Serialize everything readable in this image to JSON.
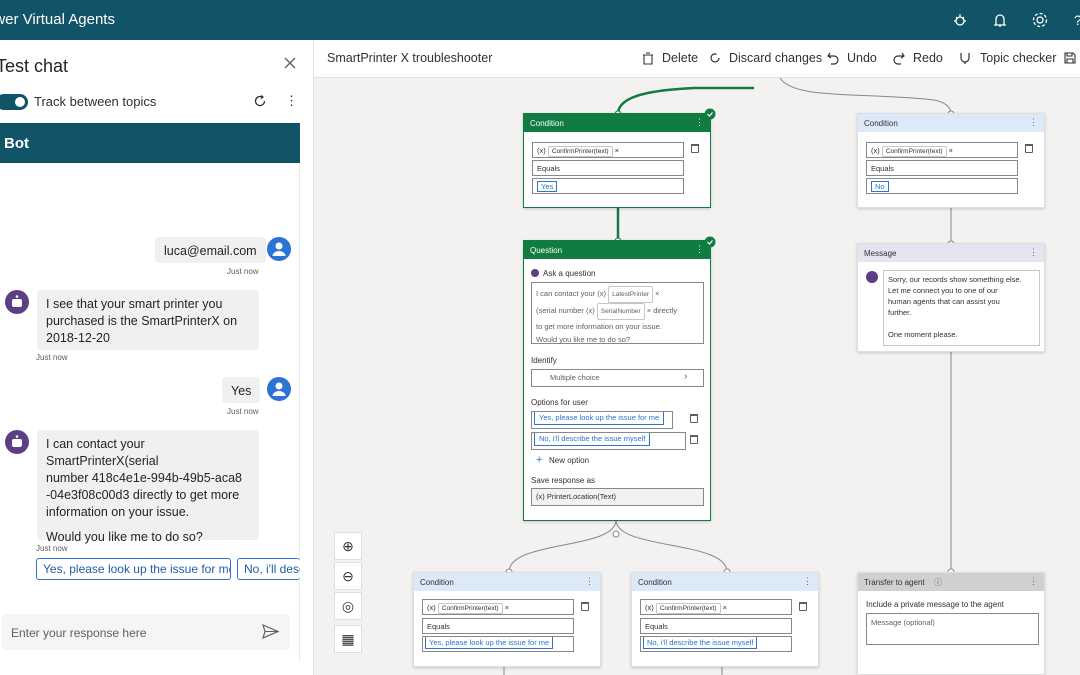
{
  "app": {
    "title": "ower Virtual Agents",
    "colors": {
      "brand": "#115468",
      "accent": "#2b73d4",
      "bot_avatar": "#5c3f84",
      "condition_ok": "#107c41"
    }
  },
  "topbar_icons": [
    "bug-icon",
    "bell-icon",
    "gear-icon",
    "help-icon"
  ],
  "chat": {
    "title": "Test chat",
    "track_label": "Track between topics",
    "track_on": true,
    "bot_header": "Bot",
    "messages": [
      {
        "from": "user",
        "text": "luca@email.com",
        "time": "Just now"
      },
      {
        "from": "bot",
        "lines": [
          "I see that your smart printer you",
          "purchased is the SmartPrinterX on",
          "2018-12-20"
        ],
        "time": "Just now"
      },
      {
        "from": "user",
        "text": "Yes",
        "time": "Just now"
      },
      {
        "from": "bot",
        "lines": [
          "I can contact your SmartPrinterX(serial",
          "number 418c4e1e-994b-49b5-aca8",
          "-04e3f08c00d3 directly to get more",
          "information on your issue.",
          "",
          "Would you like me to do so?"
        ],
        "time": "Just now"
      }
    ],
    "suggestions": [
      "Yes, please look up the issue for me",
      "No, i'll desc"
    ],
    "input_placeholder": "Enter your response here"
  },
  "canvas": {
    "topic_name": "SmartPrinter X troubleshooter",
    "toolbar": {
      "delete": "Delete",
      "discard": "Discard changes",
      "undo": "Undo",
      "redo": "Redo",
      "checker": "Topic checker"
    },
    "cond_top_left": {
      "header": "Condition",
      "var": "ConfirmPrinter(text)",
      "op": "Equals",
      "value": "Yes"
    },
    "cond_top_right": {
      "header": "Condition",
      "var": "ConfirmPrinter(text)",
      "op": "Equals",
      "value": "No"
    },
    "question": {
      "header": "Question",
      "ask_label": "Ask a question",
      "text_a": "I can contact your",
      "chip_a": "LatestPrinter",
      "text_b": "(serial number",
      "chip_b": "SerialNumber",
      "text_c": "directly",
      "text_d": "to get more information on your issue.",
      "text_e": "Would you like me to do so?",
      "identify_label": "Identify",
      "identify_value": "Multiple choice",
      "options_label": "Options for user",
      "options": [
        "Yes, please look up the issue for me",
        "No, i'll describe the issue myself"
      ],
      "new_option": "New option",
      "save_label": "Save response as",
      "save_value": "PrinterLocation(Text)"
    },
    "message": {
      "header": "Message",
      "lines": [
        "Sorry, our records show something else.",
        "Let me connect you to one of our",
        "human agents that can assist you",
        "further.",
        "",
        "One moment please."
      ]
    },
    "cond_bottom_left": {
      "header": "Condition",
      "var": "ConfirmPrinter(text)",
      "op": "Equals",
      "value": "Yes, please look up the issue for me"
    },
    "cond_bottom_mid": {
      "header": "Condition",
      "var": "ConfirmPrinter(text)",
      "op": "Equals",
      "value": "No, i'll describe the issue myself"
    },
    "transfer": {
      "header": "Transfer to agent",
      "label": "Include a private message to the agent",
      "placeholder": "Message (optional)"
    },
    "var_tag": "(x)"
  }
}
